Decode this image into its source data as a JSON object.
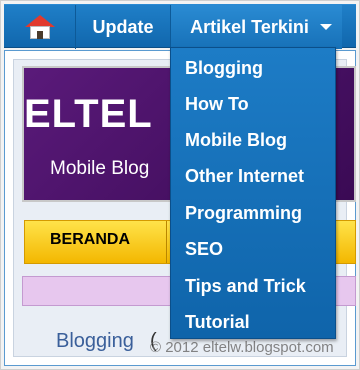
{
  "nav": {
    "home_icon": "home-icon",
    "update_label": "Update",
    "artikel_label": "Artikel Terkini",
    "caret_icon": "caret-down-icon"
  },
  "dropdown": {
    "items": [
      "Blogging",
      "How To",
      "Mobile Blog",
      "Other Internet",
      "Programming",
      "SEO",
      "Tips and Trick",
      "Tutorial"
    ]
  },
  "page": {
    "banner_title": "ELTEL",
    "banner_subtitle": "Mobile Blog",
    "menu_label": "BERANDA",
    "post_title": "Blogging",
    "post_paren": "("
  },
  "watermark": "© 2012 eltelw.blogspot.com",
  "colors": {
    "nav_blue": "#1167ad",
    "dropdown_blue": "#0f64aa",
    "banner_purple": "#3a0a54",
    "menu_yellow": "#f3b700"
  }
}
